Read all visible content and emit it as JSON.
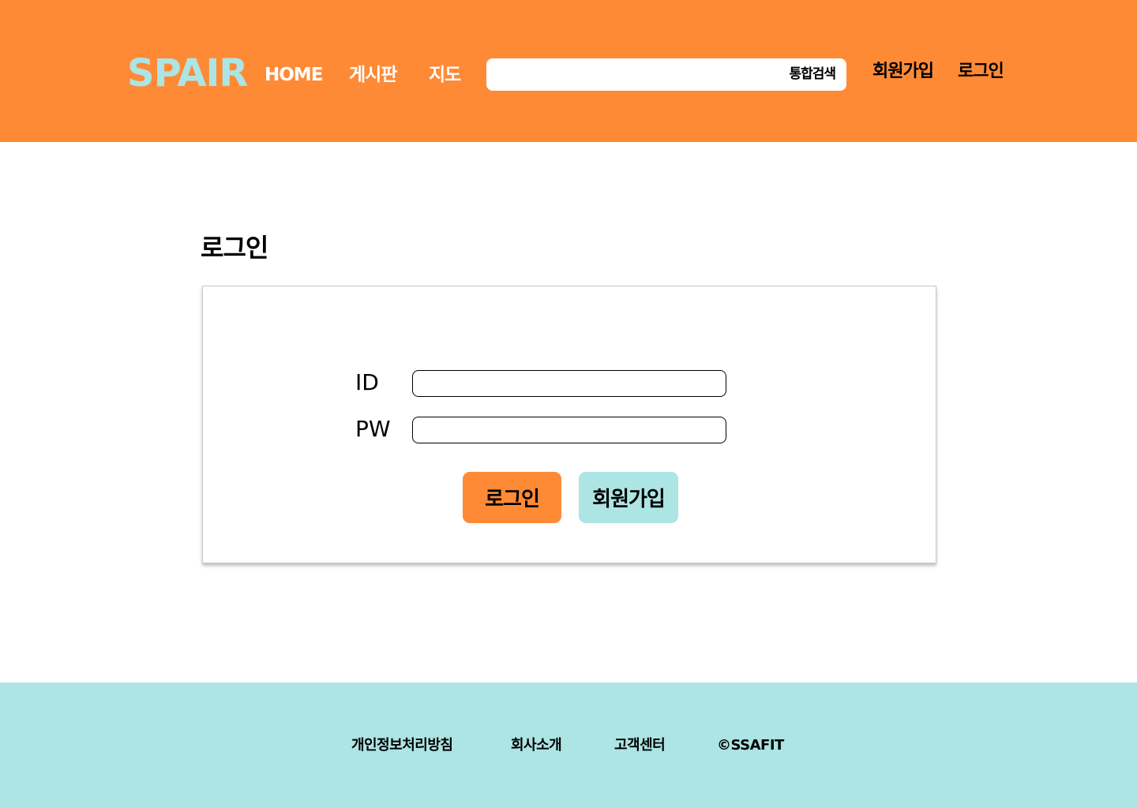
{
  "header": {
    "logo": "SPAIR",
    "nav": {
      "home": "HOME",
      "board": "게시판",
      "map": "지도"
    },
    "search": {
      "value": "",
      "button_label": "통합검색"
    },
    "signup_link": "회원가입",
    "login_link": "로그인"
  },
  "main": {
    "title": "로그인",
    "form": {
      "id_label": "ID",
      "id_value": "",
      "pw_label": "PW",
      "pw_value": "",
      "login_button": "로그인",
      "signup_button": "회원가입"
    }
  },
  "footer": {
    "links": [
      "개인정보처리방침",
      "회사소개",
      "고객센터"
    ],
    "copyright": "©SSAFIT"
  },
  "colors": {
    "header_bg": "#FF8A36",
    "accent_mint": "#ADE4E4",
    "login_button_bg": "#FF8A36",
    "signup_button_bg": "#ADE4E4",
    "footer_bg": "#ADE4E4"
  }
}
